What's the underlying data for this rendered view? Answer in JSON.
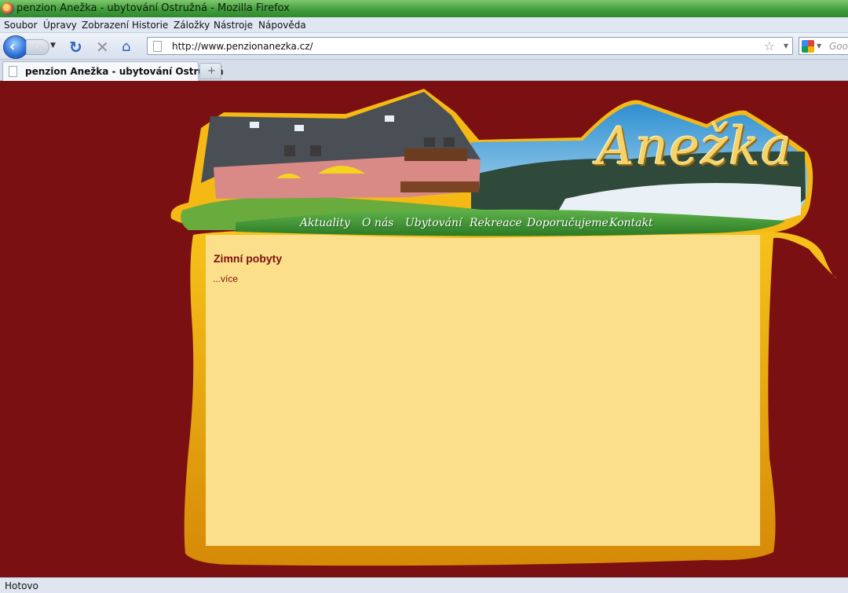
{
  "window": {
    "title": "penzion Anežka - ubytování Ostružná - Mozilla Firefox"
  },
  "menubar": {
    "items": [
      "Soubor",
      "Úpravy",
      "Zobrazení",
      "Historie",
      "Záložky",
      "Nástroje",
      "Nápověda"
    ]
  },
  "navbar": {
    "url": "http://www.penzionanezka.cz/",
    "search_placeholder": "Google"
  },
  "tabs": [
    {
      "label": "penzion Anežka - ubytování Ostružná",
      "active": true
    }
  ],
  "site": {
    "logo": "Anežka",
    "nav": [
      "Aktuality",
      "O nás",
      "Ubytování",
      "Rekreace",
      "Doporučujeme",
      "Kontakt"
    ],
    "content": {
      "title": "Zimní pobyty",
      "more_link": "...více"
    },
    "colors": {
      "background": "#7a1012",
      "panel": "#fbdf8a",
      "frame": "#e8a40d",
      "nav_band": "#3f9a3a"
    }
  },
  "status": {
    "text": "Hotovo"
  }
}
